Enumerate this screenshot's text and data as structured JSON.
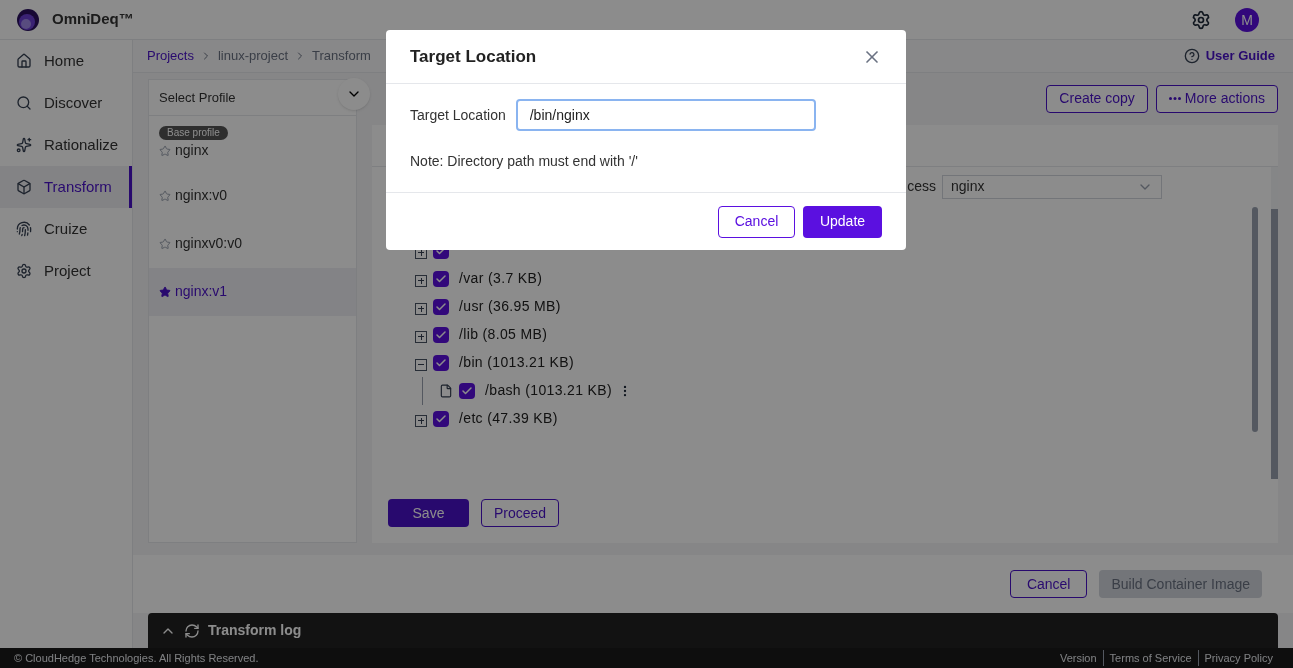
{
  "app": {
    "name": "OmniDeq™",
    "avatar": "M"
  },
  "sidebar": {
    "items": [
      {
        "label": "Home",
        "selected": false
      },
      {
        "label": "Discover",
        "selected": false
      },
      {
        "label": "Rationalize",
        "selected": false
      },
      {
        "label": "Transform",
        "selected": true
      },
      {
        "label": "Cruize",
        "selected": false
      },
      {
        "label": "Project",
        "selected": false
      }
    ]
  },
  "breadcrumb": [
    "Projects",
    "linux-project",
    "Transform"
  ],
  "user_guide": "User Guide",
  "profiles": {
    "title": "Select Profile",
    "items": [
      {
        "label": "nginx",
        "badge": "Base profile",
        "selected": false
      },
      {
        "label": "nginx:v0",
        "selected": false
      },
      {
        "label": "nginxv0:v0",
        "selected": false
      },
      {
        "label": "nginx:v1",
        "selected": true
      }
    ]
  },
  "actions": {
    "create_copy": "Create copy",
    "more_actions": "More actions"
  },
  "process": {
    "label": "cess",
    "value": "nginx"
  },
  "tree": [
    {
      "checked": true,
      "expanded": false
    },
    {
      "label": "/var",
      "size": "(3.7 KB)",
      "checked": true,
      "expanded": false
    },
    {
      "label": "/usr",
      "size": "(36.95 MB)",
      "checked": true,
      "expanded": false
    },
    {
      "label": "/lib",
      "size": "(8.05 MB)",
      "checked": true,
      "expanded": false
    },
    {
      "label": "/bin",
      "size": "(1013.21 KB)",
      "checked": true,
      "expanded": true,
      "children": [
        {
          "label": "/bash",
          "size": "(1013.21 KB)",
          "checked": true
        }
      ]
    },
    {
      "label": "/etc",
      "size": "(47.39 KB)",
      "checked": true,
      "expanded": false
    }
  ],
  "panel_buttons": {
    "save": "Save",
    "proceed": "Proceed"
  },
  "footer_actions": {
    "cancel": "Cancel",
    "build": "Build Container Image",
    "build_disabled": true
  },
  "log": {
    "title": "Transform log",
    "expanded": false
  },
  "footer": {
    "copyright": "© CloudHedge Technologies. All Rights Reserved.",
    "links": [
      "Version",
      "Terms of Service",
      "Privacy Policy"
    ]
  },
  "dialog": {
    "title": "Target Location",
    "field_label": "Target Location",
    "value": "/bin/nginx",
    "note": "Note: Directory path must end with '/'",
    "cancel": "Cancel",
    "update": "Update"
  }
}
